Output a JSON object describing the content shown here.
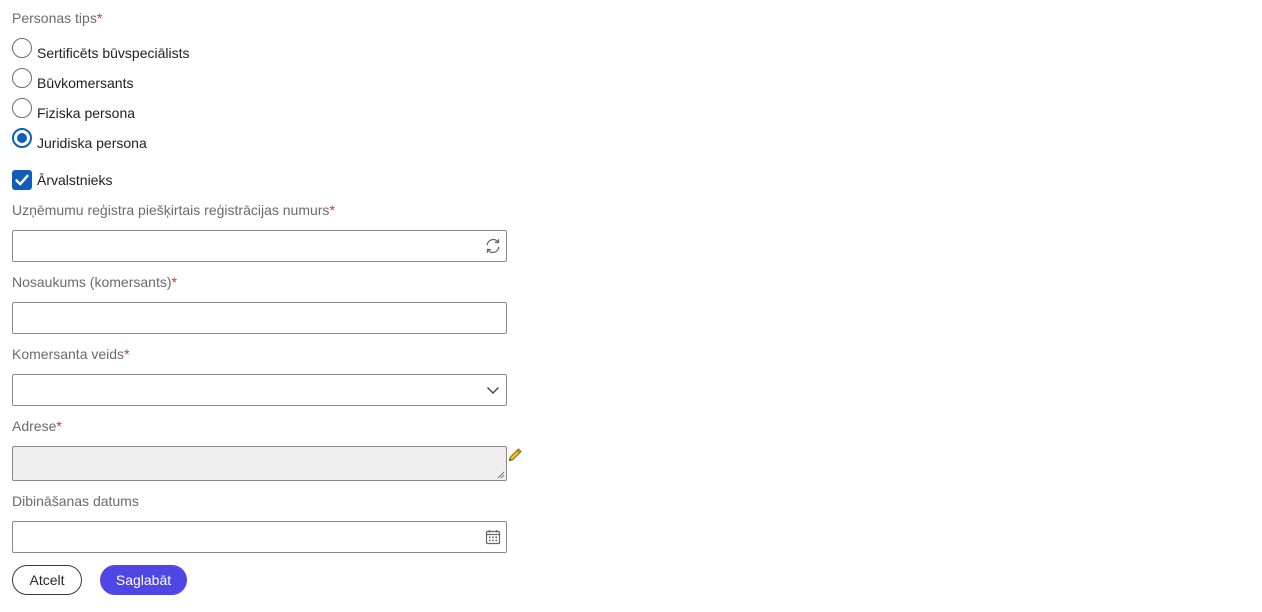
{
  "person_type": {
    "label": "Personas tips",
    "required_mark": "*",
    "options": [
      {
        "label": "Sertificēts būvspeciālists",
        "selected": false
      },
      {
        "label": "Būvkomersants",
        "selected": false
      },
      {
        "label": "Fiziska persona",
        "selected": false
      },
      {
        "label": "Juridiska persona",
        "selected": true
      }
    ]
  },
  "foreigner": {
    "label": "Ārvalstnieks",
    "checked": true
  },
  "registration_number": {
    "label": "Uzņēmumu reģistra piešķirtais reģistrācijas numurs",
    "required_mark": "*",
    "value": "",
    "icon": "refresh-icon"
  },
  "company_name": {
    "label": "Nosaukums (komersants)",
    "required_mark": "*",
    "value": ""
  },
  "company_type": {
    "label": "Komersanta veids",
    "required_mark": "*",
    "value": "",
    "icon": "chevron-down-icon"
  },
  "address": {
    "label": "Adrese",
    "required_mark": "*",
    "value": "",
    "icon": "pencil-icon"
  },
  "founding_date": {
    "label": "Dibināšanas datums",
    "value": "",
    "icon": "calendar-icon"
  },
  "actions": {
    "cancel_label": "Atcelt",
    "save_label": "Saglabāt"
  },
  "colors": {
    "accent": "#0f5fb8",
    "primary_button": "#4f46e5",
    "required": "#c0392b"
  }
}
